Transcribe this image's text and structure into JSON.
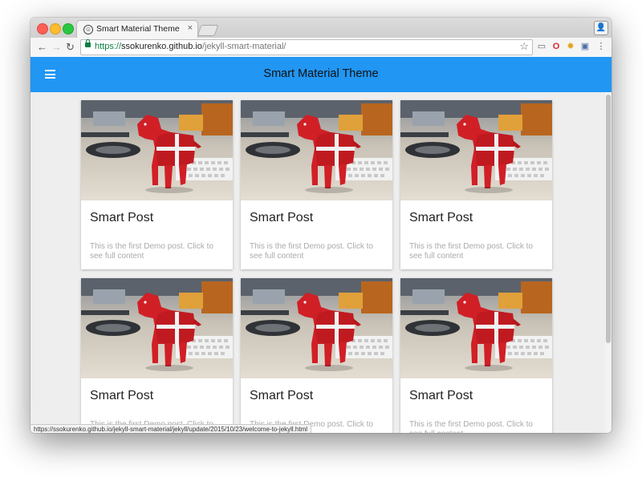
{
  "browser": {
    "tab_title": "Smart Material Theme",
    "tab_close": "×",
    "url_scheme": "https://",
    "url_host": "ssokurenko.github.io",
    "url_path": "/jekyll-smart-material/",
    "status_url": "https://ssokurenko.github.io/jekyll-smart-material/jekyll/update/2015/10/23/welcome-to-jekyll.html"
  },
  "appbar": {
    "title": "Smart Material Theme",
    "color": "#2196f3"
  },
  "posts": [
    {
      "title": "Smart Post",
      "description": "This is the first Demo post. Click to see full content"
    },
    {
      "title": "Smart Post",
      "description": "This is the first Demo post. Click to see full content"
    },
    {
      "title": "Smart Post",
      "description": "This is the first Demo post. Click to see full content"
    },
    {
      "title": "Smart Post",
      "description": "This is the first Demo post. Click to see full content"
    },
    {
      "title": "Smart Post",
      "description": "This is the first Demo post. Click to see full content"
    },
    {
      "title": "Smart Post",
      "description": "This is the first Demo post. Click to see full content"
    }
  ],
  "icons": {
    "back": "arrow-left-icon",
    "forward": "arrow-right-icon",
    "reload": "reload-icon",
    "menu": "hamburger-menu-icon",
    "bookmark": "star-icon"
  }
}
